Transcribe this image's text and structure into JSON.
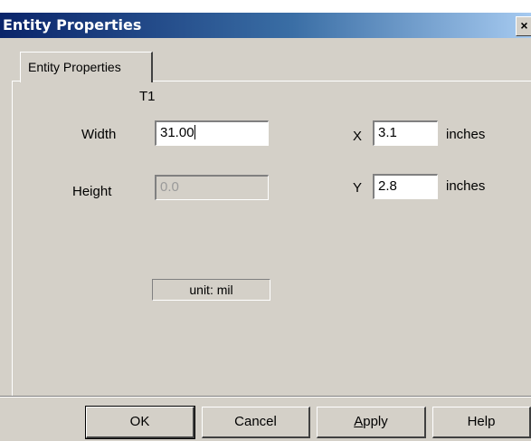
{
  "window": {
    "title": "Entity Properties",
    "close_glyph": "×"
  },
  "tab": {
    "label": "Entity Properties"
  },
  "form": {
    "entity_name": "T1",
    "width_label": "Width",
    "width_value": "31.00",
    "height_label": "Height",
    "height_value": "0.0",
    "x_label": "X",
    "x_value": "3.1",
    "x_unit": "inches",
    "y_label": "Y",
    "y_value": "2.8",
    "y_unit": "inches",
    "unit_text": "unit: mil"
  },
  "buttons": {
    "ok": "OK",
    "cancel": "Cancel",
    "apply_accel": "A",
    "apply_rest": "pply",
    "help": "Help"
  },
  "colors": {
    "face": "#d4d0c8",
    "title_start": "#0a246a",
    "title_end": "#a6caf0"
  }
}
